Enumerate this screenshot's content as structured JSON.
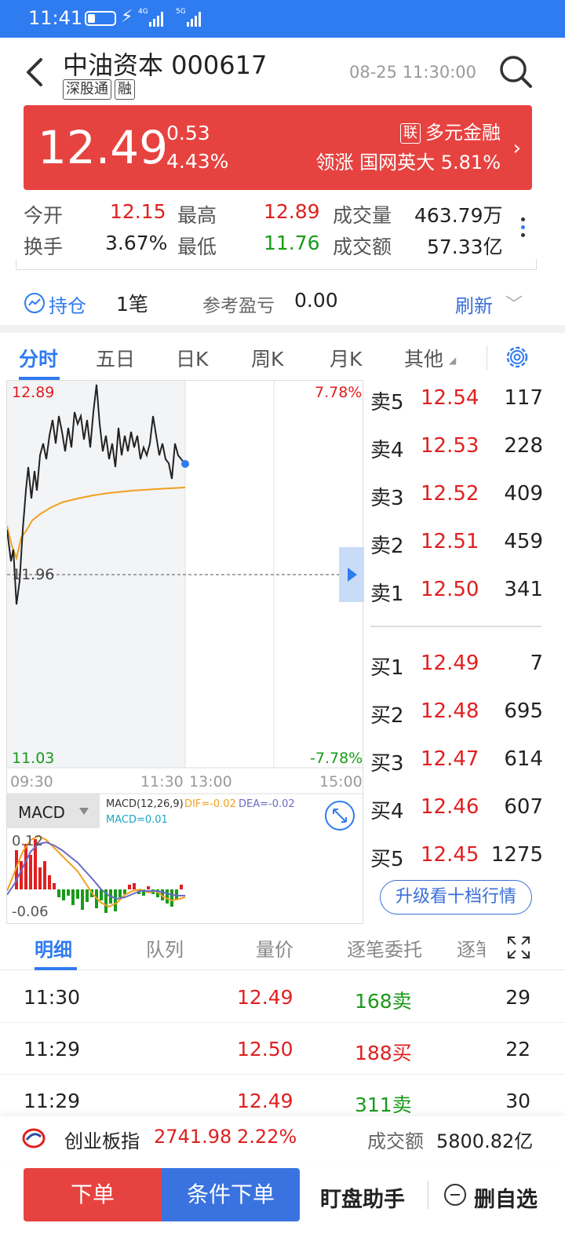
{
  "status_bar": {
    "time": "11:41",
    "net1": "4G",
    "net2": "5G"
  },
  "header": {
    "stock_name": "中油资本 000617",
    "tags": [
      "深股通",
      "融"
    ],
    "update_time": "08-25 11:30:00"
  },
  "quote": {
    "price": "12.49",
    "change": "0.53",
    "change_pct": "4.43%",
    "sector_badge": "联",
    "sector_name": "多元金融",
    "leader_text": "领涨 国网英大 5.81%"
  },
  "stats": {
    "open_label": "今开",
    "open": "12.15",
    "high_label": "最高",
    "high": "12.89",
    "volume_label": "成交量",
    "volume": "463.79万",
    "turnover_label": "换手",
    "turnover": "3.67%",
    "low_label": "最低",
    "low": "11.76",
    "amount_label": "成交额",
    "amount": "57.33亿"
  },
  "holding": {
    "label": "持仓",
    "value": "1笔",
    "pnl_label": "参考盈亏",
    "pnl": "0.00",
    "refresh": "刷新"
  },
  "chart_tabs": [
    "分时",
    "五日",
    "日K",
    "周K",
    "月K",
    "其他"
  ],
  "chart": {
    "y_max": "12.89",
    "y_mid": "11.96",
    "y_min": "11.03",
    "pct_max": "7.78%",
    "pct_min": "-7.78%",
    "times": [
      "09:30",
      "11:30",
      "13:00",
      "15:00"
    ],
    "macd_selector": "MACD",
    "macd_params": "MACD(12,26,9)",
    "dif": "DIF=-0.02",
    "dea": "DEA=-0.02",
    "macd_val": "MACD=0.01",
    "macd_top": "0.12",
    "macd_bottom": "-0.06",
    "colors": {
      "up": "#e02020",
      "down": "#1a9a1a",
      "avg_line": "#f0a020",
      "accent": "#2f7bf0"
    }
  },
  "order_book": {
    "asks": [
      {
        "label": "卖5",
        "price": "12.54",
        "vol": "117"
      },
      {
        "label": "卖4",
        "price": "12.53",
        "vol": "228"
      },
      {
        "label": "卖3",
        "price": "12.52",
        "vol": "409"
      },
      {
        "label": "卖2",
        "price": "12.51",
        "vol": "459"
      },
      {
        "label": "卖1",
        "price": "12.50",
        "vol": "341"
      }
    ],
    "bids": [
      {
        "label": "买1",
        "price": "12.49",
        "vol": "7"
      },
      {
        "label": "买2",
        "price": "12.48",
        "vol": "695"
      },
      {
        "label": "买3",
        "price": "12.47",
        "vol": "614"
      },
      {
        "label": "买4",
        "price": "12.46",
        "vol": "607"
      },
      {
        "label": "买5",
        "price": "12.45",
        "vol": "1275"
      }
    ],
    "upgrade_btn": "升级看十档行情"
  },
  "detail_tabs": [
    "明细",
    "队列",
    "量价",
    "逐笔委托",
    "逐笔"
  ],
  "trades": [
    {
      "time": "11:30",
      "price": "12.49",
      "vol": "168卖",
      "count": "29",
      "side": "sell"
    },
    {
      "time": "11:29",
      "price": "12.50",
      "vol": "188买",
      "count": "22",
      "side": "buy"
    },
    {
      "time": "11:29",
      "price": "12.49",
      "vol": "311卖",
      "count": "30",
      "side": "sell"
    }
  ],
  "index_bar": {
    "name": "创业板指",
    "value": "2741.98",
    "pct": "2.22%",
    "amount_label": "成交额",
    "amount": "5800.82亿"
  },
  "actions": {
    "order": "下单",
    "conditional": "条件下单",
    "assistant": "盯盘助手",
    "remove": "删自选"
  }
}
